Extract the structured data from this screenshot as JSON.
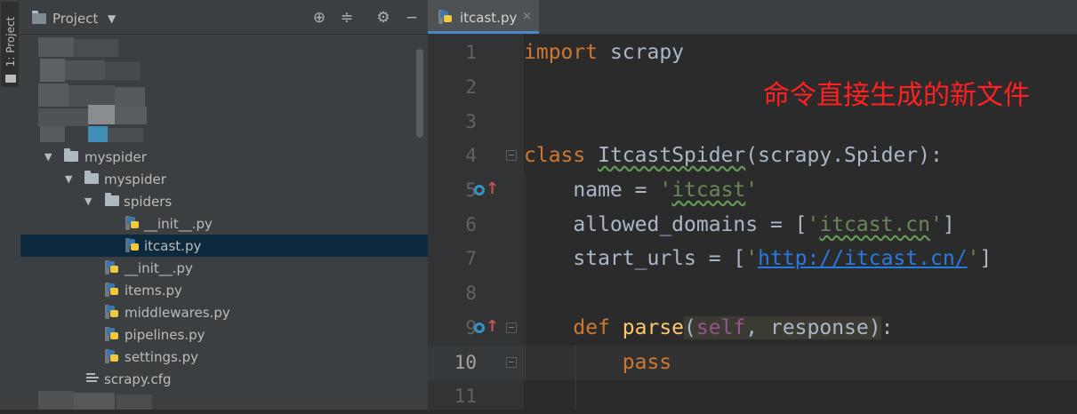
{
  "tool_strip": {
    "label": "1: Project"
  },
  "project": {
    "title": "Project",
    "tree": [
      {
        "label": "myspider",
        "kind": "folder",
        "level": 0,
        "expanded": true
      },
      {
        "label": "myspider",
        "kind": "folder",
        "level": 1,
        "expanded": true
      },
      {
        "label": "spiders",
        "kind": "folder",
        "level": 2,
        "expanded": true
      },
      {
        "label": "__init__.py",
        "kind": "py",
        "level": 3
      },
      {
        "label": "itcast.py",
        "kind": "py",
        "level": 3,
        "selected": true
      },
      {
        "label": "__init__.py",
        "kind": "py",
        "level": 2
      },
      {
        "label": "items.py",
        "kind": "py",
        "level": 2
      },
      {
        "label": "middlewares.py",
        "kind": "py",
        "level": 2
      },
      {
        "label": "pipelines.py",
        "kind": "py",
        "level": 2
      },
      {
        "label": "settings.py",
        "kind": "py",
        "level": 2
      },
      {
        "label": "scrapy.cfg",
        "kind": "cfg",
        "level": 1
      }
    ]
  },
  "editor": {
    "tab": {
      "label": "itcast.py",
      "close": "×"
    },
    "line_numbers": [
      "1",
      "2",
      "3",
      "4",
      "5",
      "6",
      "7",
      "8",
      "9",
      "10",
      "11"
    ],
    "current_line": "10",
    "code": {
      "l1_kw": "import",
      "l1_rest": " scrapy",
      "l4_kw": "class",
      "l4_sp": " ",
      "l4_name": "ItcastSpider",
      "l4_rest": "(scrapy.Spider):",
      "l5_lead": "    name = ",
      "l5_q1": "'",
      "l5_str": "itcast",
      "l5_q2": "'",
      "l6_lead": "    allowed_domains = [",
      "l6_q1": "'",
      "l6_str": "itcast.cn",
      "l6_q2": "'",
      "l6_end": "]",
      "l7_lead": "    start_urls = [",
      "l7_q1": "'",
      "l7_url": "http://itcast.cn/",
      "l7_q2": "'",
      "l7_end": "]",
      "l9_lead": "    ",
      "l9_kw": "def",
      "l9_fn": " parse",
      "l9_paren": "(",
      "l9_self": "self",
      "l9_args": ", response",
      "l9_close": ")",
      "l9_end": ":",
      "l10_lead": "        ",
      "l10_kw": "pass"
    }
  },
  "annotation": "命令直接生成的新文件",
  "colors": {
    "keyword": "#cc7832",
    "string": "#6a8759",
    "url": "#287bde",
    "annotation": "#ff2020",
    "selection": "#0d293e"
  }
}
